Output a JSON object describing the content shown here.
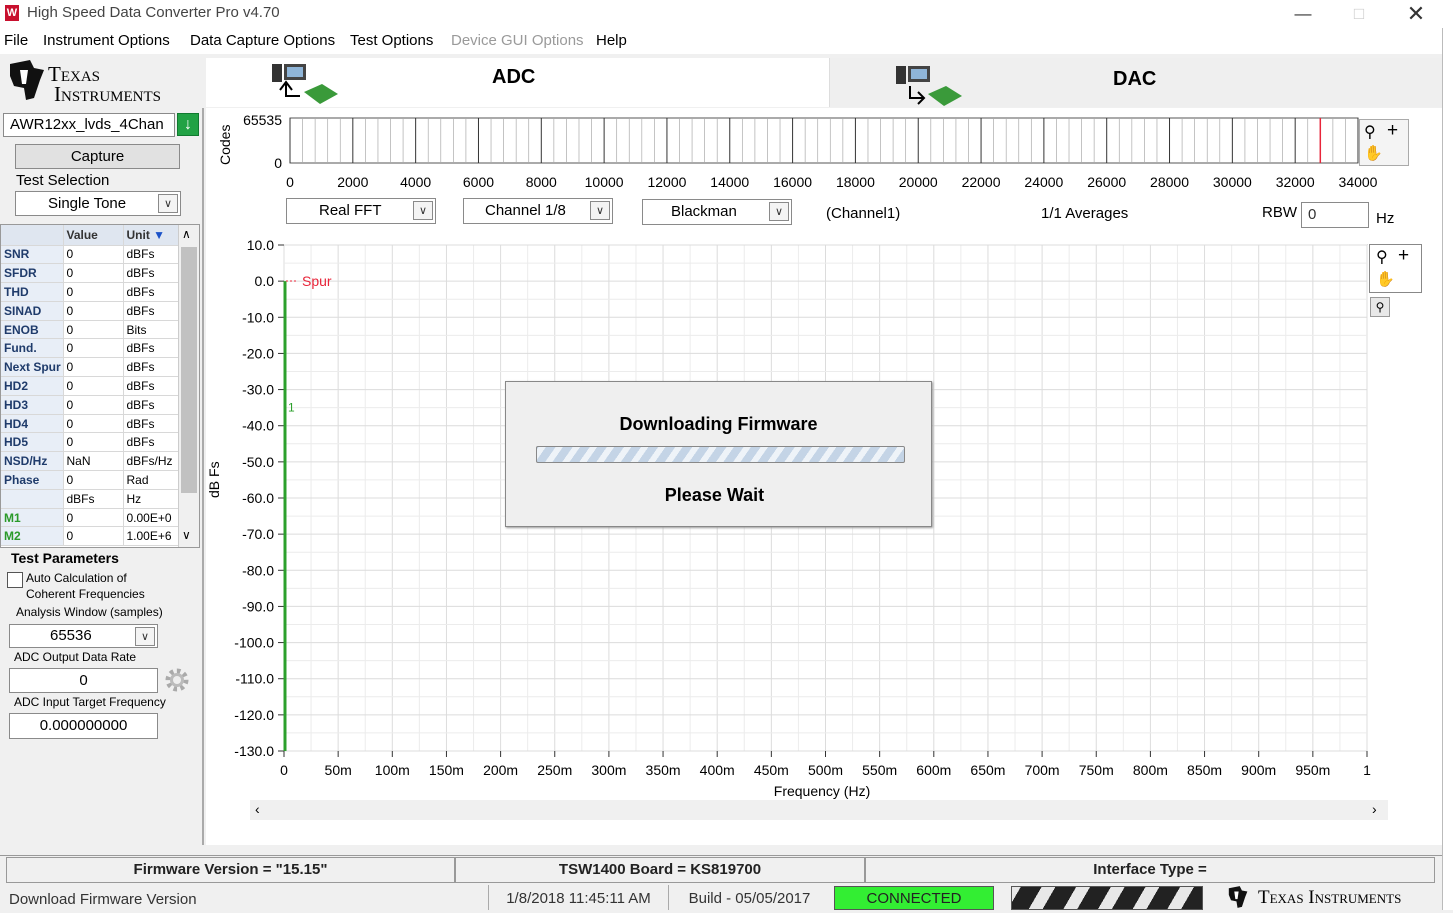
{
  "app": {
    "title": "High Speed Data Converter Pro v4.70"
  },
  "menu": [
    "File",
    "Instrument Options",
    "Data Capture Options",
    "Test Options",
    "Device GUI Options",
    "Help"
  ],
  "logo": {
    "line1": "Texas",
    "line2": "Instruments"
  },
  "tabs": {
    "adc": "ADC",
    "dac": "DAC"
  },
  "left": {
    "device": "AWR12xx_lvds_4Chan",
    "capture": "Capture",
    "test_selection_label": "Test Selection",
    "test_selection": "Single Tone",
    "test_params_label": "Test Parameters",
    "auto_calc": "Auto Calculation of Coherent Frequencies",
    "analysis_window_label": "Analysis Window (samples)",
    "analysis_window": "65536",
    "output_rate_label": "ADC Output Data Rate",
    "output_rate": "0",
    "target_freq_label": "ADC Input Target Frequency",
    "target_freq": "0.000000000"
  },
  "measurements": {
    "headers": [
      "",
      "Value",
      "Unit"
    ],
    "rows": [
      [
        "SNR",
        "0",
        "dBFs"
      ],
      [
        "SFDR",
        "0",
        "dBFs"
      ],
      [
        "THD",
        "0",
        "dBFs"
      ],
      [
        "SINAD",
        "0",
        "dBFs"
      ],
      [
        "ENOB",
        "0",
        "Bits"
      ],
      [
        "Fund.",
        "0",
        "dBFs"
      ],
      [
        "Next Spur",
        "0",
        "dBFs"
      ],
      [
        "HD2",
        "0",
        "dBFs"
      ],
      [
        "HD3",
        "0",
        "dBFs"
      ],
      [
        "HD4",
        "0",
        "dBFs"
      ],
      [
        "HD5",
        "0",
        "dBFs"
      ],
      [
        "NSD/Hz",
        "NaN",
        "dBFs/Hz"
      ],
      [
        "Phase",
        "0",
        "Rad"
      ],
      [
        "",
        "dBFs",
        "Hz"
      ],
      [
        "M1",
        "0",
        "0.00E+0"
      ],
      [
        "M2",
        "0",
        "1.00E+6"
      ]
    ]
  },
  "controls": {
    "fft_type": "Real FFT",
    "channel": "Channel 1/8",
    "window": "Blackman",
    "channel_note": "(Channel1)",
    "averages": "1/1 Averages",
    "rbw_label": "RBW",
    "rbw_value": "0",
    "rbw_unit": "Hz"
  },
  "chart_data": [
    {
      "type": "line",
      "title": "",
      "xlabel": "",
      "ylabel": "Codes",
      "xlim": [
        0,
        34000
      ],
      "ylim": [
        0,
        65535
      ],
      "x_ticks": [
        0,
        2000,
        4000,
        6000,
        8000,
        10000,
        12000,
        14000,
        16000,
        18000,
        20000,
        22000,
        24000,
        26000,
        28000,
        30000,
        32000,
        34000
      ],
      "y_ticks": [
        "0",
        "65535"
      ],
      "marker_x": 32800,
      "series": []
    },
    {
      "type": "line",
      "title": "",
      "xlabel": "Frequency (Hz)",
      "ylabel": "dB Fs",
      "xlim": [
        0,
        1
      ],
      "ylim": [
        -130,
        10
      ],
      "x_tick_labels": [
        "0",
        "50m",
        "100m",
        "150m",
        "200m",
        "250m",
        "300m",
        "350m",
        "400m",
        "450m",
        "500m",
        "550m",
        "600m",
        "650m",
        "700m",
        "750m",
        "800m",
        "850m",
        "900m",
        "950m",
        "1"
      ],
      "y_tick_labels": [
        "10.0",
        "0.0",
        "-10.0",
        "-20.0",
        "-30.0",
        "-40.0",
        "-50.0",
        "-60.0",
        "-70.0",
        "-80.0",
        "-90.0",
        "-100.0",
        "-110.0",
        "-120.0",
        "-130.0"
      ],
      "annotations": [
        {
          "text": "Spur",
          "x": 0,
          "y": 0
        },
        {
          "text": "1",
          "x": 0,
          "y": -35
        }
      ],
      "grid": true,
      "series": []
    }
  ],
  "dialog": {
    "title": "Downloading Firmware",
    "message": "Please Wait",
    "progress": 1.0
  },
  "status": {
    "firmware": "Firmware Version = \"15.15\"",
    "board": "TSW1400 Board = KS819700",
    "interface": "Interface Type =",
    "left_text": "Download Firmware Version",
    "datetime": "1/8/2018 11:45:11 AM",
    "build": "Build  - 05/05/2017",
    "connection": "CONNECTED",
    "footer_logo": "Texas Instruments"
  },
  "colors": {
    "connected": "#33ee33",
    "spur": "#e8253a",
    "marker": "#e8253a",
    "trace": "#2ca02c",
    "ti_red": "#c8102e"
  }
}
